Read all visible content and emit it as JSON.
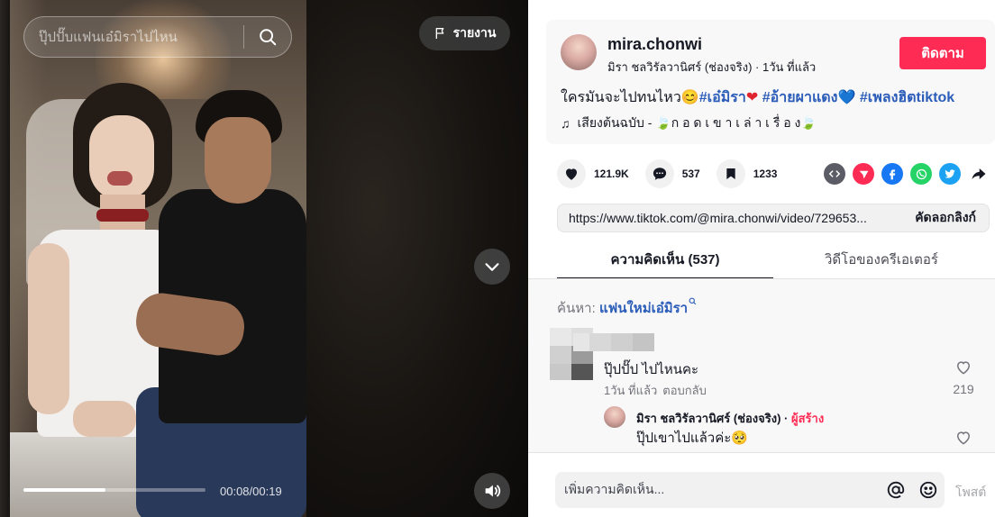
{
  "video": {
    "search_placeholder": "ปุ๊ปปั๊บแฟนเอ๋มิราไปไหน",
    "report_label": "รายงาน",
    "time_readout": "00:08/00:19",
    "progress_fraction": 0.45
  },
  "post": {
    "username": "mira.chonwi",
    "display_name": "มิรา ชลวิรัลวานิศร์ (ช่องจริง)",
    "separator": " · ",
    "time_ago": "1วัน ที่แล้ว",
    "follow_label": "ติดตาม",
    "caption_text": "ใครมันจะไปทนไหว😊",
    "hashtags": [
      "#เอ๋มิรา",
      "#อ้ายผาแดง",
      "#เพลงฮิตtiktok"
    ],
    "hashtag_emojis": [
      "❤",
      "💙"
    ],
    "music_note": "♫",
    "music_text": "เสียงต้นฉบับ - ",
    "music_leaf": "🍃",
    "music_title": "ก อ ด เ ข า เ ล่ า เ รื่ อ ง"
  },
  "stats": {
    "likes": "121.9K",
    "comments": "537",
    "saves": "1233"
  },
  "link": {
    "url": "https://www.tiktok.com/@mira.chonwi/video/729653...",
    "copy_label": "คัดลอกลิงก์"
  },
  "tabs": {
    "comments": "ความคิดเห็น (537)",
    "creator_videos": "วิดีโอของครีเอเตอร์"
  },
  "comments": {
    "search_prefix": "ค้นหา: ",
    "search_keyword": "แฟนใหม่เอ๋มิรา",
    "items": [
      {
        "text": "ปุ๊ปปั๊ป ไปไหนคะ",
        "time": "1วัน ที่แล้ว",
        "reply_label": "ตอบกลับ",
        "likes": "219"
      }
    ],
    "reply": {
      "name": "มิรา ชลวิรัลวานิศร์ (ช่องจริง)",
      "separator": " · ",
      "creator_badge": "ผู้สร้าง",
      "text": "ปุ๊ปเขาไปแล้วค่ะ🥺"
    }
  },
  "composer": {
    "placeholder": "เพิ่มความคิดเห็น...",
    "post_label": "โพสต์"
  },
  "colors": {
    "accent": "#fe2c55",
    "hashtag": "#2b5db9",
    "facebook": "#1877f2",
    "whatsapp": "#25d366",
    "twitter": "#1da1f2",
    "send": "#fe2c55",
    "embed": "#5c5c66"
  }
}
